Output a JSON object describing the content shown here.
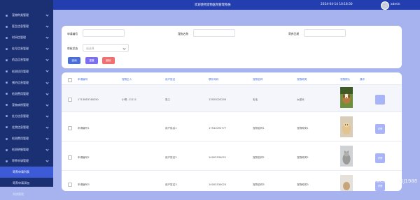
{
  "topbar": {
    "title": "欢迎使用宠物医院管理系统",
    "datetime": "2024-04-14 10:18:30",
    "username": "admin"
  },
  "sidebar": {
    "items": [
      {
        "label": "宠物种类管理"
      },
      {
        "label": "医生信息管理"
      },
      {
        "label": "时间信管理"
      },
      {
        "label": "挂号信息管理"
      },
      {
        "label": "药品信息管理"
      },
      {
        "label": "检测项目管理"
      },
      {
        "label": "预约信息管理"
      },
      {
        "label": "检测费用管理"
      },
      {
        "label": "宠物病例管理"
      },
      {
        "label": "处方信息管理"
      },
      {
        "label": "住院信息管理"
      },
      {
        "label": "检测费用管理"
      },
      {
        "label": "检测明细管理"
      },
      {
        "label": "寄养申请管理"
      }
    ],
    "subitems": [
      {
        "label": "寄养申请列表",
        "active": true
      },
      {
        "label": "寄养申请添加",
        "active": false
      },
      {
        "label": "系统管理",
        "active": false
      }
    ]
  },
  "search": {
    "fields": [
      {
        "label": "申请编号",
        "placeholder": ""
      },
      {
        "label": "宠物名称",
        "placeholder": ""
      },
      {
        "label": "寄养日期",
        "placeholder": ""
      },
      {
        "label": "审核状态",
        "placeholder": "请选择"
      }
    ],
    "buttons": {
      "query": "查询",
      "reset": "重置",
      "delete": "删除"
    }
  },
  "table": {
    "headers": [
      "申请编号",
      "宠物主人",
      "用户姓名",
      "联系号码",
      "宠物名称",
      "宠物种类",
      "宠物照片",
      "操作"
    ],
    "rows": [
      {
        "id": "1713063748250",
        "owner": "小明 -11111",
        "name": "张三",
        "phone": "13923023203",
        "pet": "毛毛",
        "kind": "大型犬",
        "op": ""
      },
      {
        "id": "申请编号1",
        "owner": "",
        "name": "用户姓名1",
        "phone": "17541092777",
        "pet": "宠物名称1",
        "kind": "宠物种类1",
        "op": "详情"
      },
      {
        "id": "申请编号2",
        "owner": "",
        "name": "用户姓名2",
        "phone": "14003330021",
        "pet": "宠物名称2",
        "kind": "宠物种类2",
        "op": "详情"
      },
      {
        "id": "申请编号3",
        "owner": "",
        "name": "用户姓名3",
        "phone": "14003330023",
        "pet": "宠物名称3",
        "kind": "宠物种类3",
        "op": "详情"
      }
    ]
  },
  "watermark": "CSDN @weixin_BYSJ1988",
  "colors": {
    "sidebar": "#1b2f73",
    "topbar": "#223eaf",
    "background": "#a6b3ee",
    "accent": "#4a6fd8",
    "reset": "#7b6ef0",
    "delete": "#f07070"
  }
}
